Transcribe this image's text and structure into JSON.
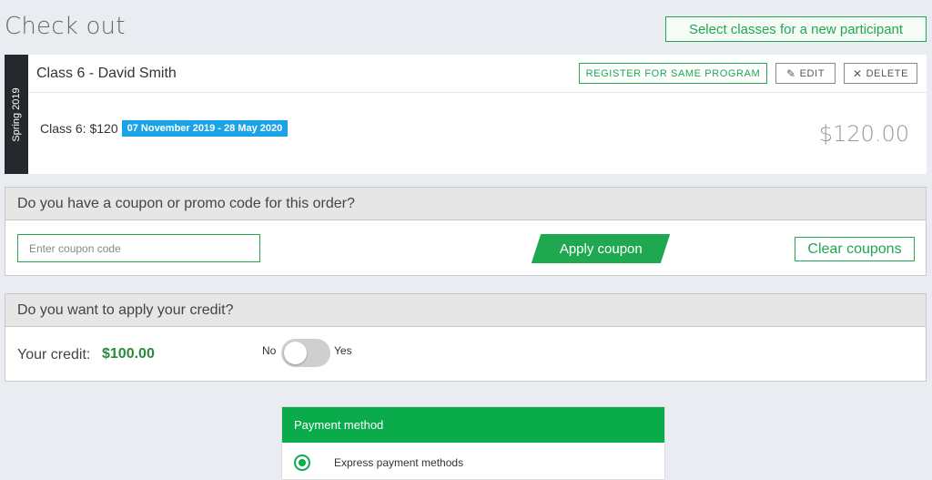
{
  "page": {
    "title": "Check out",
    "new_participant_label": "Select classes for a new participant"
  },
  "class_card": {
    "term": "Spring 2019",
    "title": "Class 6 - David Smith",
    "register_label": "REGISTER FOR SAME PROGRAM",
    "edit_label": "EDIT",
    "delete_label": "DELETE",
    "line_label": "Class 6: $120",
    "date_range": "07 November 2019 - 28 May 2020",
    "price": "$120.00"
  },
  "coupon": {
    "heading": "Do you have a coupon or promo code for this order?",
    "placeholder": "Enter coupon code",
    "apply_label": "Apply coupon",
    "clear_label": "Clear coupons"
  },
  "credit": {
    "heading": "Do you want to apply your credit?",
    "label": "Your credit:",
    "amount": "$100.00",
    "toggle_no": "No",
    "toggle_yes": "Yes",
    "toggle_on": false
  },
  "payment": {
    "heading": "Payment method",
    "options": [
      {
        "label": "Express payment methods",
        "selected": true
      }
    ]
  },
  "colors": {
    "accent_green": "#1fa84f",
    "payment_green": "#0aab4b",
    "date_badge_blue": "#1aa3e8",
    "term_strip": "#24292e",
    "credit_green": "#2a8a3e"
  },
  "icons": {
    "edit": "pencil-icon",
    "delete": "close-icon",
    "radio": "radio-selected-icon"
  }
}
